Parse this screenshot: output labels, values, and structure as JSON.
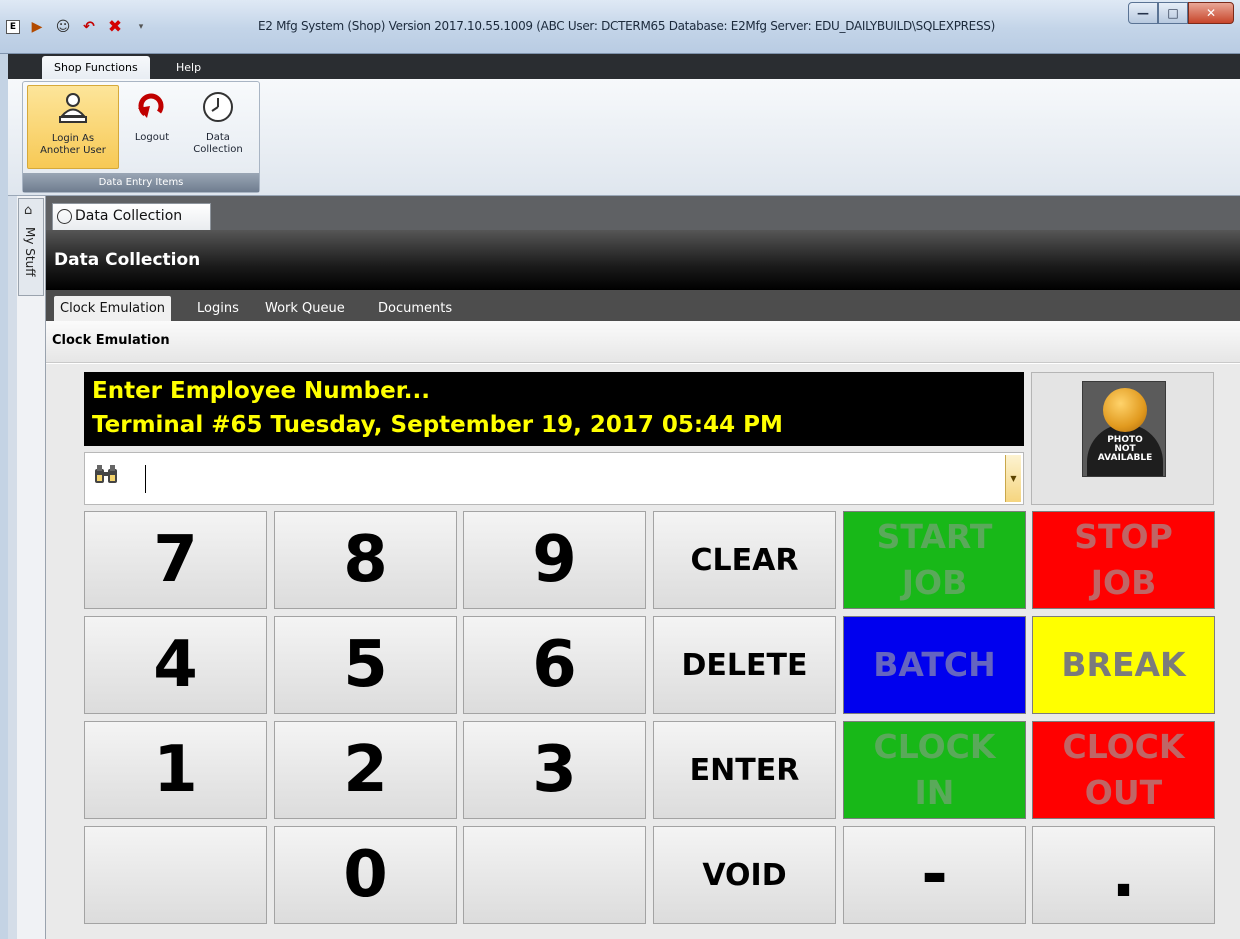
{
  "window": {
    "title": "E2 Mfg System (Shop) Version 2017.10.55.1009 (ABC User: DCTERM65 Database: E2Mfg Server: EDU_DAILYBUILD\\SQLEXPRESS)",
    "quick_access_icons": [
      "app-icon",
      "login-icon",
      "user-icon",
      "undo-icon",
      "close-x-icon",
      "dropdown-icon"
    ],
    "controls": [
      "minimize",
      "maximize",
      "close"
    ]
  },
  "ribbon": {
    "tabs": [
      "Shop Functions",
      "Help"
    ],
    "active_tab": "Shop Functions",
    "group_label": "Data Entry Items",
    "buttons": [
      {
        "label": "Login As Another User",
        "icon": "login-user-icon"
      },
      {
        "label": "Logout",
        "icon": "logout-icon"
      },
      {
        "label": "Data Collection",
        "icon": "clock-icon"
      }
    ]
  },
  "sidebar": {
    "label": "My Stuff",
    "icon": "home-icon"
  },
  "document_tab": {
    "label": "Data Collection"
  },
  "header": {
    "title": "Data Collection"
  },
  "subtabs": [
    "Clock Emulation",
    "Logins",
    "Work Queue",
    "Documents"
  ],
  "active_subtab": "Clock Emulation",
  "section_title": "Clock Emulation",
  "display": {
    "line1": "Enter Employee Number...",
    "line2": "Terminal #65  Tuesday, September 19, 2017 05:44 PM"
  },
  "input": {
    "value": ""
  },
  "photo": {
    "text": "PHOTO\nNOT\nAVAILABLE"
  },
  "keypad": {
    "row1": [
      "7",
      "8",
      "9",
      "CLEAR",
      "START\nJOB",
      "STOP\nJOB"
    ],
    "row2": [
      "4",
      "5",
      "6",
      "DELETE",
      "BATCH",
      "BREAK"
    ],
    "row3": [
      "1",
      "2",
      "3",
      "ENTER",
      "CLOCK\nIN",
      "CLOCK\nOUT"
    ],
    "row4": [
      "",
      "0",
      "",
      "VOID",
      "-",
      "."
    ]
  },
  "colors": {
    "display_bg": "#000000",
    "display_text": "#ffff00",
    "green": "#18b818",
    "red": "#ff0000",
    "blue": "#0000ee",
    "yellow": "#ffff00"
  }
}
